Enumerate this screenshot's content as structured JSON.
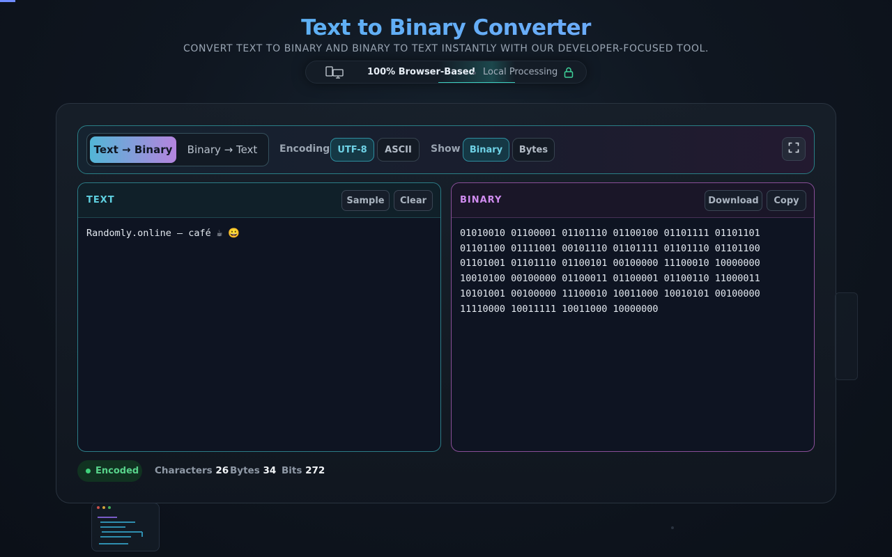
{
  "header": {
    "title": "Text to Binary Converter",
    "subtitle": "CONVERT TEXT TO BINARY AND BINARY TO TEXT INSTANTLY WITH OUR DEVELOPER-FOCUSED TOOL.",
    "badge_primary": "100% Browser-Based",
    "badge_secondary": "Local Processing",
    "badge_icons": [
      "devices-icon",
      "lock-icon"
    ]
  },
  "toolbar": {
    "modes": [
      {
        "label": "Text → Binary",
        "active": true
      },
      {
        "label": "Binary → Text",
        "active": false
      }
    ],
    "encoding_label": "Encoding",
    "encodings": [
      {
        "label": "UTF-8",
        "active": true
      },
      {
        "label": "ASCII",
        "active": false
      }
    ],
    "show_label": "Show",
    "show_options": [
      {
        "label": "Binary",
        "active": true
      },
      {
        "label": "Bytes",
        "active": false
      }
    ],
    "fullscreen_icon": "fullscreen-icon"
  },
  "input_card": {
    "title": "TEXT",
    "sample_label": "Sample",
    "clear_label": "Clear",
    "value": "Randomly.online — café ☕ 😀"
  },
  "output_card": {
    "title": "BINARY",
    "download_label": "Download",
    "copy_label": "Copy",
    "value": "01010010 01100001 01101110 01100100 01101111 01101101\n01101100 01111001 00101110 01101111 01101110 01101100\n01101001 01101110 01100101 00100000 11100010 10000000\n10010100 00100000 01100011 01100001 01100110 11000011\n10101001 00100000 11100010 10011000 10010101 00100000\n11110000 10011111 10011000 10000000"
  },
  "status": {
    "state": "Encoded",
    "characters_label": "Characters",
    "characters": "26",
    "bytes_label": "Bytes",
    "bytes": "34",
    "bits_label": "Bits",
    "bits": "272"
  },
  "colors": {
    "accent_cyan": "#5fd0e0",
    "accent_purple": "#d08cf0",
    "status_green": "#58d38b"
  }
}
